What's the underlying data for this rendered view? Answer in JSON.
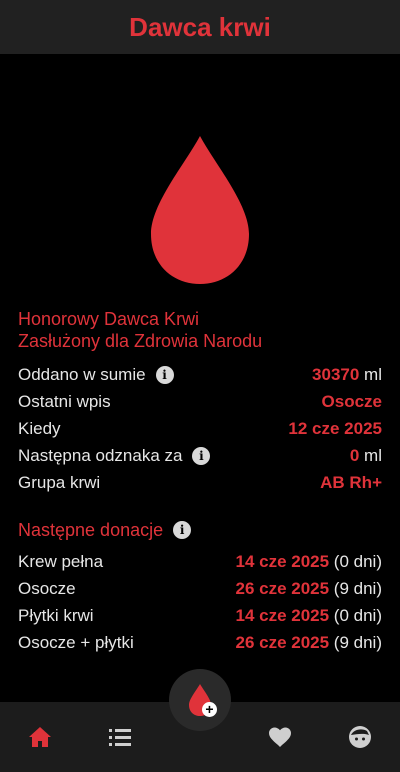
{
  "app": {
    "title": "Dawca krwi"
  },
  "honor": {
    "line1": "Honorowy Dawca Krwi",
    "line2": "Zasłużony dla Zdrowia Narodu"
  },
  "stats": [
    {
      "label": "Oddano w sumie",
      "info": true,
      "value": "30370",
      "unit": " ml"
    },
    {
      "label": "Ostatni wpis",
      "info": false,
      "value": "Osocze",
      "unit": ""
    },
    {
      "label": "Kiedy",
      "info": false,
      "value": "12 cze 2025",
      "unit": ""
    },
    {
      "label": "Następna odznaka za",
      "info": true,
      "value": "0",
      "unit": " ml"
    },
    {
      "label": "Grupa krwi",
      "info": false,
      "value": "AB Rh+",
      "unit": ""
    }
  ],
  "next": {
    "title": "Następne donacje",
    "items": [
      {
        "label": "Krew pełna",
        "date": "14 cze 2025",
        "days": " (0 dni)"
      },
      {
        "label": "Osocze",
        "date": "26 cze 2025",
        "days": " (9 dni)"
      },
      {
        "label": "Płytki krwi",
        "date": "14 cze 2025",
        "days": " (0 dni)"
      },
      {
        "label": "Osocze + płytki",
        "date": "26 cze 2025",
        "days": " (9 dni)"
      }
    ]
  },
  "icons": {
    "hero": "blood-drop-icon",
    "info": "info-icon",
    "fab": "add-donation-icon",
    "nav": [
      "home-icon",
      "list-icon",
      "heart-icon",
      "profile-face-icon"
    ]
  },
  "colors": {
    "accent": "#e0333a",
    "background": "#000000",
    "bar": "#212121"
  },
  "info_glyph": "i",
  "fab_plus": "+"
}
